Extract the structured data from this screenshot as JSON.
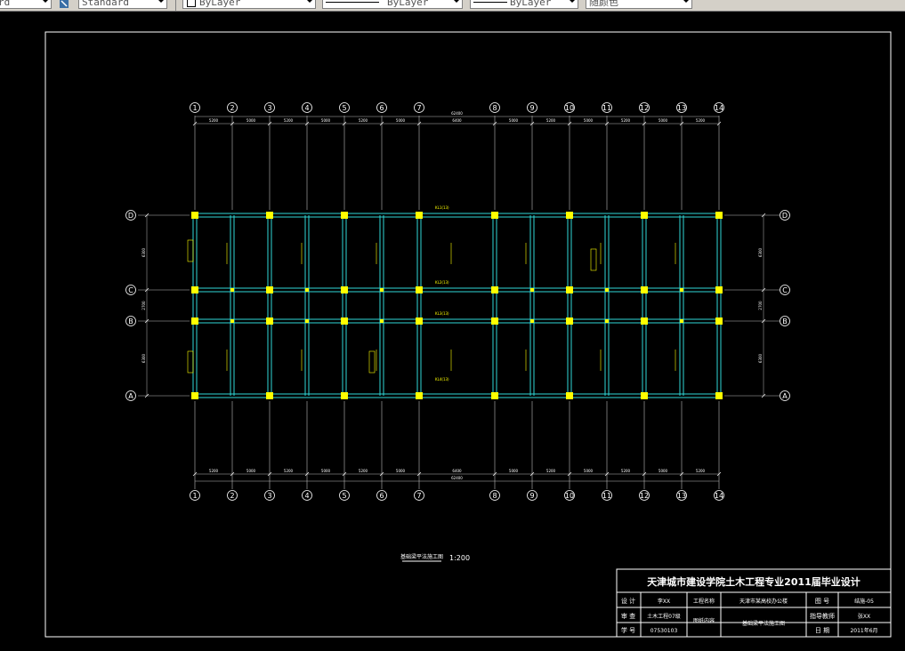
{
  "toolbar": {
    "field0_value": "rd",
    "text_style": "Standard",
    "layer": "ByLayer",
    "linetype": "ByLayer",
    "lineweight": "ByLayer",
    "color": "随颜色"
  },
  "drawing": {
    "axis_numbers": [
      "1",
      "2",
      "3",
      "4",
      "5",
      "6",
      "7",
      "8",
      "9",
      "10",
      "11",
      "12",
      "13",
      "14"
    ],
    "row_labels": [
      "D",
      "C",
      "B",
      "A"
    ],
    "total_dim": "62400",
    "bay_dims": [
      "5200",
      "5000",
      "5200",
      "5000",
      "5200",
      "5000",
      "6400",
      "5000",
      "5200",
      "5000",
      "5200",
      "5000",
      "5200"
    ],
    "side_dims_left": [
      "6300",
      "2700",
      "6300"
    ],
    "side_dims_right": [
      "6300",
      "2700",
      "6300"
    ],
    "plan_title": "基础梁平法施工图",
    "scale": "1:200",
    "beam_tags": [
      "KL1(13)",
      "KL2(13)",
      "KL3(13)",
      "KL4(13)"
    ]
  },
  "title_block": {
    "school_title": "天津城市建设学院土木工程专业2011届毕业设计",
    "design_label": "设 计",
    "designer": "李XX",
    "check_label": "审 查",
    "major_class": "土木工程07级",
    "id_label": "学 号",
    "id_value": "07530103",
    "proj_label": "工程名称",
    "proj_value": "天津市某高校办公楼",
    "drawing_name_label": "图纸内容",
    "drawing_name": "基础梁平法施工图",
    "no_label": "图 号",
    "no_value": "结施-05",
    "advisor_label": "指导教师",
    "advisor_value": "张XX",
    "date_label": "日 期",
    "date_value": "2011年6月"
  }
}
